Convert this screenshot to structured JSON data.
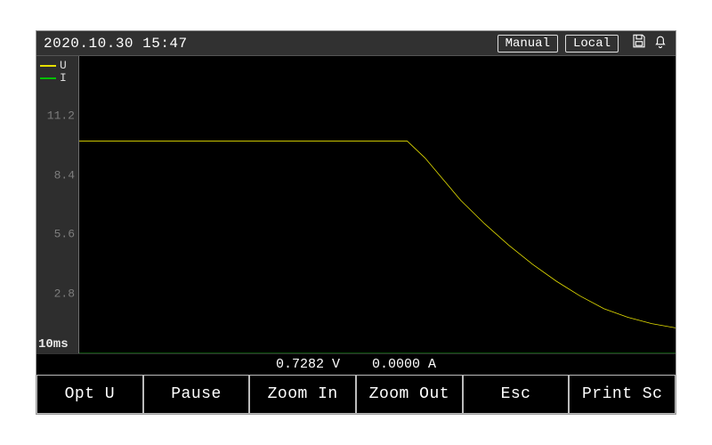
{
  "header": {
    "datetime": "2020.10.30 15:47",
    "manual_label": "Manual",
    "local_label": "Local"
  },
  "legend": {
    "items": [
      {
        "label": "U",
        "color": "#e6e000"
      },
      {
        "label": "I",
        "color": "#00c000"
      }
    ]
  },
  "axis": {
    "y_ticks": [
      "11.2",
      "8.4",
      "5.6",
      "2.8"
    ],
    "y_min": 0,
    "y_max": 14,
    "timebase": "10ms"
  },
  "status": {
    "voltage": "0.7282 V",
    "current": "0.0000 A"
  },
  "softkeys": [
    "Opt U",
    "Pause",
    "Zoom In",
    "Zoom Out",
    "Esc",
    "Print Sc"
  ],
  "chart_data": {
    "type": "line",
    "title": "",
    "xlabel": "",
    "ylabel": "",
    "xlim": [
      0,
      100
    ],
    "ylim": [
      0,
      14
    ],
    "y_ticks": [
      2.8,
      5.6,
      8.4,
      11.2
    ],
    "series": [
      {
        "name": "U",
        "color": "#e6e000",
        "x": [
          0,
          55,
          58,
          61,
          64,
          68,
          72,
          76,
          80,
          84,
          88,
          92,
          96,
          100
        ],
        "values": [
          10.0,
          10.0,
          9.2,
          8.2,
          7.2,
          6.1,
          5.1,
          4.2,
          3.4,
          2.7,
          2.1,
          1.7,
          1.4,
          1.2
        ]
      },
      {
        "name": "I",
        "color": "#00c000",
        "x": [
          0,
          100
        ],
        "values": [
          0.0,
          0.0
        ]
      }
    ]
  }
}
